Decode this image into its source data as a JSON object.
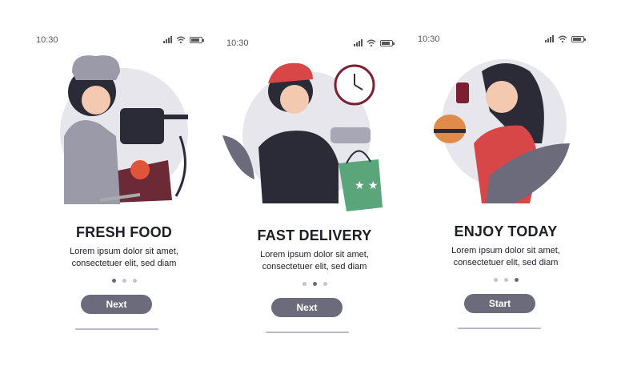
{
  "screens": [
    {
      "time": "10:30",
      "title": "FRESH FOOD",
      "desc_line1": "Lorem ipsum dolor sit amet,",
      "desc_line2": "consectetuer elit, sed diam",
      "button_label": "Next",
      "active_page": 1,
      "illustration": "chef-cooking"
    },
    {
      "time": "10:30",
      "title": "FAST DELIVERY",
      "desc_line1": "Lorem ipsum dolor sit amet,",
      "desc_line2": "consectetuer elit, sed diam",
      "button_label": "Next",
      "active_page": 2,
      "illustration": "courier-with-clock"
    },
    {
      "time": "10:30",
      "title": "ENJOY TODAY",
      "desc_line1": "Lorem ipsum dolor sit amet,",
      "desc_line2": "consectetuer elit, sed diam",
      "button_label": "Start",
      "active_page": 3,
      "illustration": "woman-eating-burger"
    }
  ],
  "colors": {
    "button": "#6b6b7b",
    "dot_active": "#6a6a78",
    "dot_inactive": "#c4c4cc",
    "home_indicator": "#b9b9c3",
    "illustration_bg": "#e6e6ec"
  },
  "icons": [
    "signal-icon",
    "wifi-icon",
    "battery-icon"
  ]
}
